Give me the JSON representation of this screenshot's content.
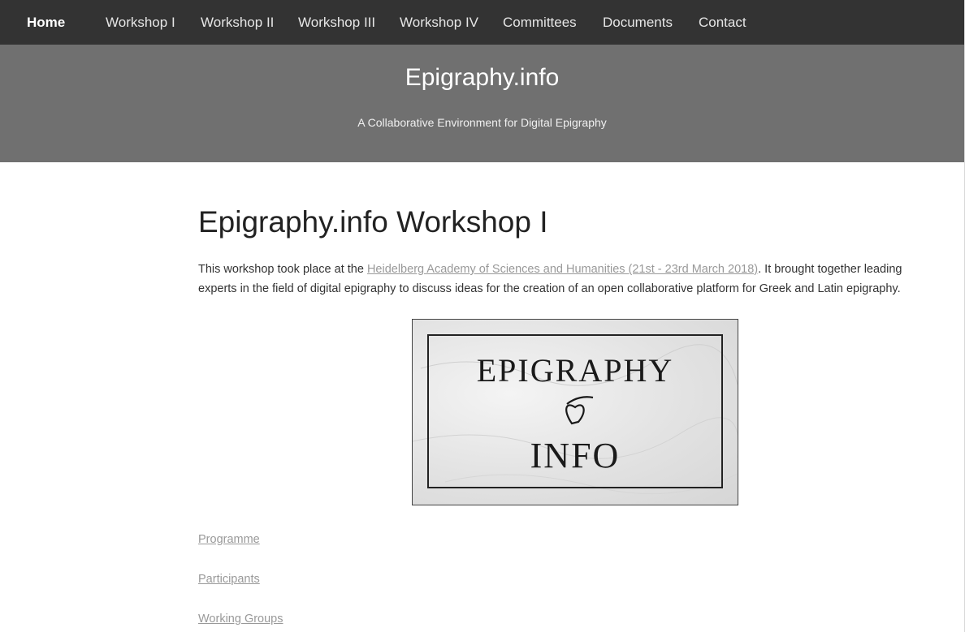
{
  "nav": {
    "home": "Home",
    "items": [
      "Workshop I",
      "Workshop II",
      "Workshop III",
      "Workshop IV",
      "Committees",
      "Documents",
      "Contact"
    ]
  },
  "hero": {
    "title": "Epigraphy.info",
    "subtitle": "A Collaborative Environment for Digital Epigraphy"
  },
  "main": {
    "title": "Epigraphy.info Workshop I",
    "intro_before": "This workshop took place at the ",
    "intro_link": "Heidelberg Academy of Sciences and Humanities (21st - 23rd March 2018)",
    "intro_after": ". It brought together leading experts in the field of digital epigraphy to discuss ideas for the creation of an open collaborative platform for Greek and Latin epigraphy.",
    "logo": {
      "line1": "EPIGRAPHY",
      "line2": "INFO"
    },
    "links": [
      "Programme",
      "Participants",
      "Working Groups"
    ]
  },
  "colors": {
    "navbar": "#333333",
    "hero": "#707070",
    "link": "#999999"
  }
}
